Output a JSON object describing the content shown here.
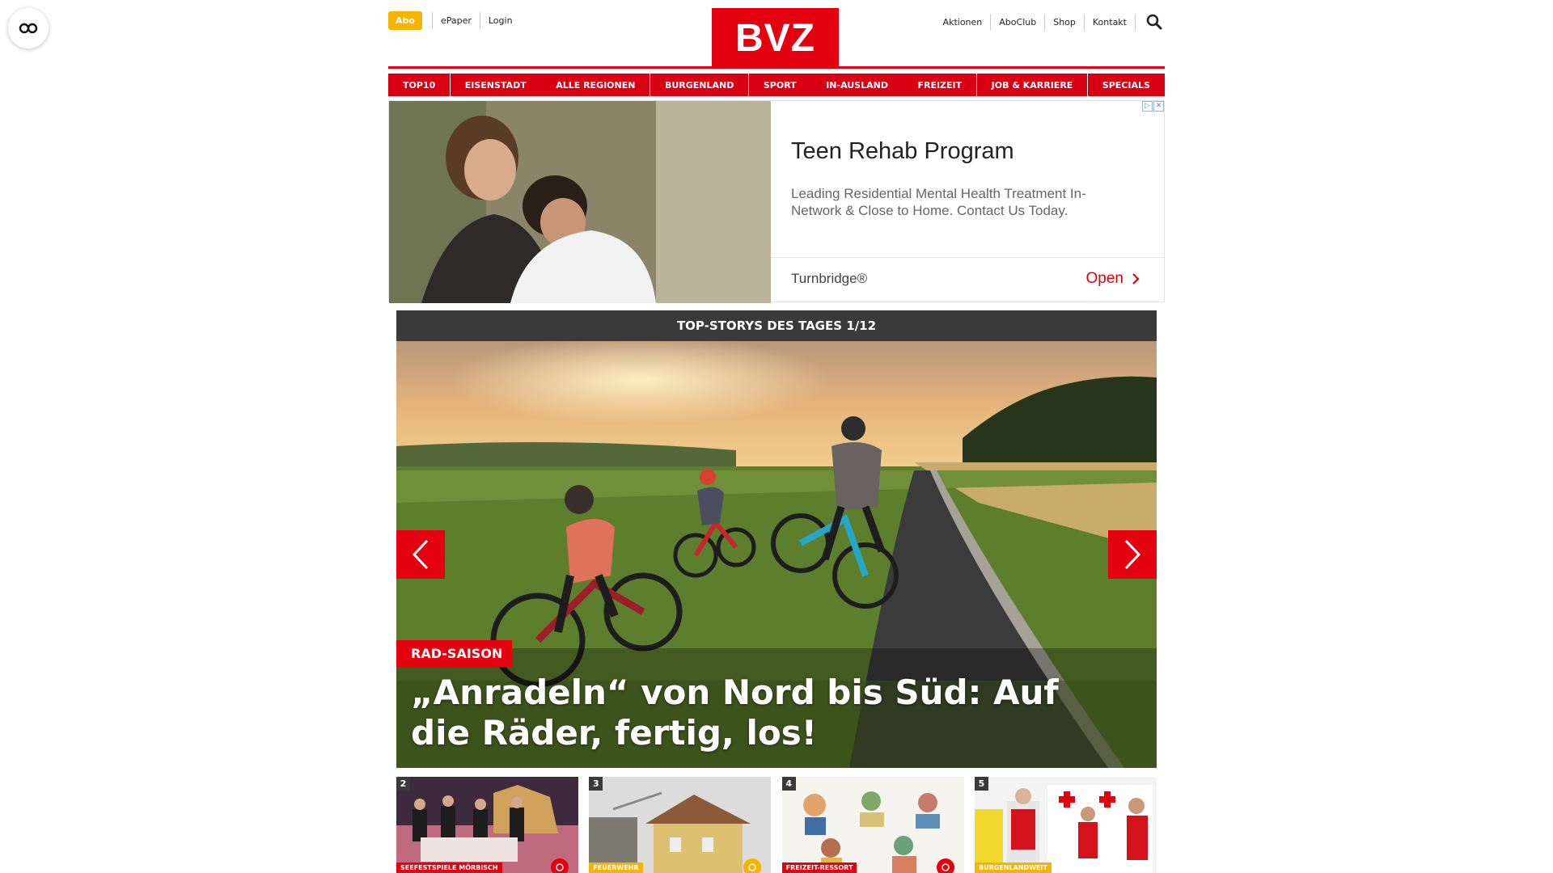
{
  "utility": {
    "abo": "Abo",
    "epaper": "ePaper",
    "login": "Login",
    "aktionen": "Aktionen",
    "aboclub": "AboClub",
    "shop": "Shop",
    "kontakt": "Kontakt"
  },
  "logo": "BVZ",
  "nav": [
    "TOP10",
    "EISENSTADT",
    "ALLE REGIONEN",
    "BURGENLAND",
    "SPORT",
    "IN-AUSLAND",
    "FREIZEIT",
    "JOB & KARRIERE",
    "SPECIALS"
  ],
  "ad": {
    "title": "Teen Rehab Program",
    "description": "Leading Residential Mental Health Treatment In-Network & Close to Home. Contact Us Today.",
    "brand": "Turnbridge®",
    "cta": "Open"
  },
  "top_stories": {
    "header": "TOP-STORYS DES TAGES 1/12",
    "hero_tag": "RAD-SAISON",
    "hero_title": "„Anradeln“ von Nord bis Süd: Auf die Räder, fertig, los!"
  },
  "thumbnails": [
    {
      "num": "2",
      "tag": "SEEFESTSPIELE MÖRBISCH"
    },
    {
      "num": "3",
      "tag": "FEUERWEHR"
    },
    {
      "num": "4",
      "tag": "FREIZEIT-RESSORT"
    },
    {
      "num": "5",
      "tag": "BURGENLANDWEIT"
    }
  ],
  "colors": {
    "brand_red": "#e3000f",
    "abo_yellow": "#f6b400",
    "header_dark": "#3a3a3a"
  },
  "icons": [
    "glasses-icon",
    "search-icon",
    "chevron-left-icon",
    "chevron-right-icon",
    "camera-icon",
    "ad-choices-icon"
  ]
}
